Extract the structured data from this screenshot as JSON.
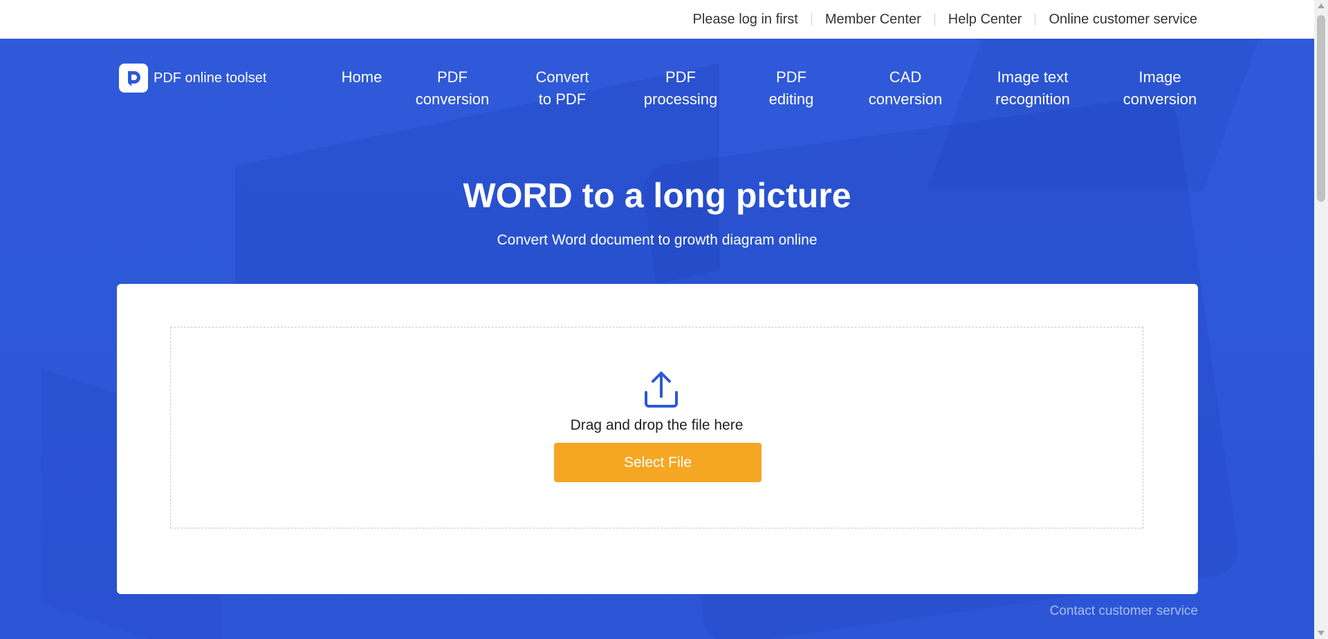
{
  "topbar": {
    "links": [
      "Please log in first",
      "Member Center",
      "Help Center",
      "Online customer service"
    ]
  },
  "brand": {
    "name": "PDF online toolset"
  },
  "nav": {
    "items": [
      {
        "line1": "Home",
        "line2": ""
      },
      {
        "line1": "PDF",
        "line2": "conversion"
      },
      {
        "line1": "Convert",
        "line2": "to PDF"
      },
      {
        "line1": "PDF",
        "line2": "processing"
      },
      {
        "line1": "PDF",
        "line2": "editing"
      },
      {
        "line1": "CAD",
        "line2": "conversion"
      },
      {
        "line1": "Image text",
        "line2": "recognition"
      },
      {
        "line1": "Image",
        "line2": "conversion"
      }
    ]
  },
  "hero": {
    "title": "WORD to a long picture",
    "subtitle": "Convert Word document to growth diagram online"
  },
  "upload": {
    "drop_text": "Drag and drop the file here",
    "button_label": "Select File"
  },
  "footer": {
    "contact": "Contact customer service"
  },
  "colors": {
    "hero_blue": "#2d58d7",
    "button_orange": "#f5a623",
    "icon_blue": "#2d58d7",
    "contact_text": "#a9bdf0"
  },
  "icons": {
    "upload": "upload-icon",
    "logo": "pdf-logo-icon"
  }
}
